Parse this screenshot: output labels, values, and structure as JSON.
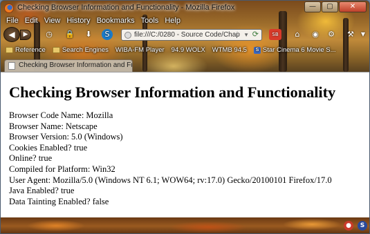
{
  "window": {
    "title": "Checking Browser Information and Functionality - Mozilla Firefox",
    "minimize_glyph": "—",
    "maximize_glyph": "▢",
    "close_glyph": "✕"
  },
  "menu": {
    "items": [
      "File",
      "Edit",
      "View",
      "History",
      "Bookmarks",
      "Tools",
      "Help"
    ]
  },
  "nav": {
    "back_icon": "back-arrow-icon",
    "url": "file:///C:/0280 - Source Code/Chap"
  },
  "bookmarks": {
    "items": [
      {
        "label": "Reference",
        "icon": "folder-icon"
      },
      {
        "label": "Search Engines",
        "icon": "folder-icon"
      },
      {
        "label": "WIBA-FM Player",
        "icon": "none"
      },
      {
        "label": "94.9 WOLX",
        "icon": "none"
      },
      {
        "label": "WTMB 94.5",
        "icon": "none"
      },
      {
        "label": "Star Cinema 6 Movie S...",
        "icon": "site-favicon",
        "favicon_text": "S"
      }
    ]
  },
  "tab": {
    "label": "Checking Browser Information and Func..."
  },
  "content": {
    "heading": "Checking Browser Information and Functionality",
    "lines": [
      "Browser Code Name: Mozilla",
      "Browser Name: Netscape",
      "Browser Version: 5.0 (Windows)",
      "Cookies Enabled? true",
      "Online? true",
      "Compiled for Platform: Win32",
      "User Agent: Mozilla/5.0 (Windows NT 6.1; WOW64; rv:17.0) Gecko/20100101 Firefox/17.0",
      "Java Enabled? true",
      "Data Tainting Enabled? false"
    ]
  },
  "colors": {
    "content_background": "#ffffff",
    "text": "#000000",
    "close_button": "#c0402a"
  }
}
